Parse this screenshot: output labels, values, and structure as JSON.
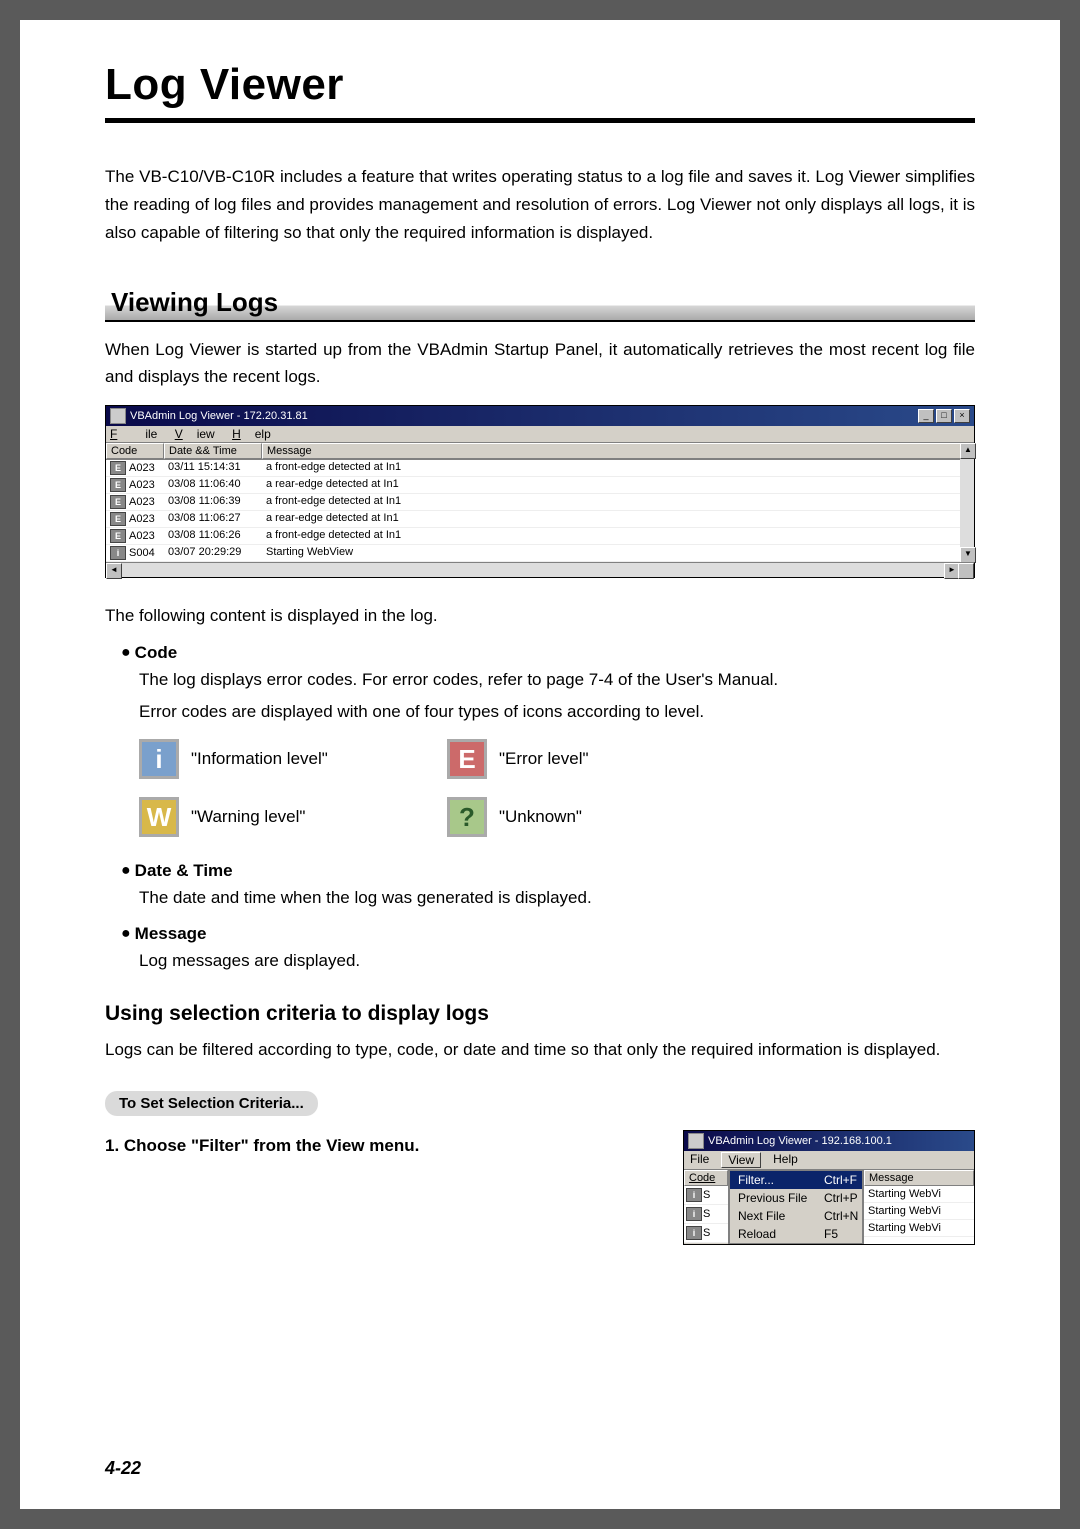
{
  "page_title": "Log Viewer",
  "intro": "The VB-C10/VB-C10R includes a feature that writes operating status to a log file and saves it. Log Viewer simplifies the reading of log files and provides management and resolution of errors.  Log Viewer not only displays all logs, it is also capable of filtering so that only the required information is displayed.",
  "section1_title": "Viewing Logs",
  "section1_para": "When Log Viewer is started up from the VBAdmin Startup Panel, it automatically retrieves the most recent log file and displays the recent logs.",
  "shot1": {
    "title": "VBAdmin Log Viewer - 172.20.31.81",
    "menu": {
      "file": "File",
      "view": "View",
      "help": "Help"
    },
    "cols": {
      "code": "Code",
      "datetime": "Date && Time",
      "message": "Message"
    },
    "rows": [
      {
        "icon": "E",
        "code": "A023",
        "dt": "03/11 15:14:31",
        "msg": "a front-edge detected at In1"
      },
      {
        "icon": "E",
        "code": "A023",
        "dt": "03/08 11:06:40",
        "msg": "a rear-edge detected at In1"
      },
      {
        "icon": "E",
        "code": "A023",
        "dt": "03/08 11:06:39",
        "msg": "a front-edge detected at In1"
      },
      {
        "icon": "E",
        "code": "A023",
        "dt": "03/08 11:06:27",
        "msg": "a rear-edge detected at In1"
      },
      {
        "icon": "E",
        "code": "A023",
        "dt": "03/08 11:06:26",
        "msg": "a front-edge detected at In1"
      },
      {
        "icon": "i",
        "code": "S004",
        "dt": "03/07 20:29:29",
        "msg": "Starting WebView"
      }
    ]
  },
  "log_disp_intro": "The following content is displayed in the log.",
  "code_head": "Code",
  "code_body1": "The log displays error codes. For error codes, refer to page 7-4 of the User's Manual.",
  "code_body2": "Error codes are displayed with one of four types of icons according to level.",
  "levels": {
    "info": "\"Information level\"",
    "error": "\"Error level\"",
    "warn": "\"Warning level\"",
    "unknown": "\"Unknown\""
  },
  "datetime_head": "Date & Time",
  "datetime_body": "The date and time when the log was generated is displayed.",
  "message_head": "Message",
  "message_body": "Log messages are displayed.",
  "sub_title": "Using selection criteria to display logs",
  "sub_para": "Logs can be filtered according to type, code, or date and time so that only the required information is displayed.",
  "pill": "To Set Selection Criteria...",
  "step1": "1.  Choose \"Filter\" from the View menu.",
  "shot2": {
    "title": "VBAdmin Log Viewer - 192.168.100.1",
    "menu": {
      "file": "File",
      "view": "View",
      "help": "Help"
    },
    "cols": {
      "code": "Code",
      "message": "Message"
    },
    "dropdown": [
      {
        "label": "Filter...",
        "accel": "Ctrl+F",
        "hi": true
      },
      {
        "label": "Previous File",
        "accel": "Ctrl+P",
        "hi": false
      },
      {
        "label": "Next File",
        "accel": "Ctrl+N",
        "hi": false
      },
      {
        "label": "Reload",
        "accel": "F5",
        "hi": false
      }
    ],
    "left_rows": [
      {
        "icon": "i",
        "code": "S"
      },
      {
        "icon": "i",
        "code": "S"
      },
      {
        "icon": "i",
        "code": "S"
      }
    ],
    "right_rows": [
      "Starting WebVi",
      "Starting WebVi",
      "Starting WebVi"
    ]
  },
  "page_number": "4-22"
}
